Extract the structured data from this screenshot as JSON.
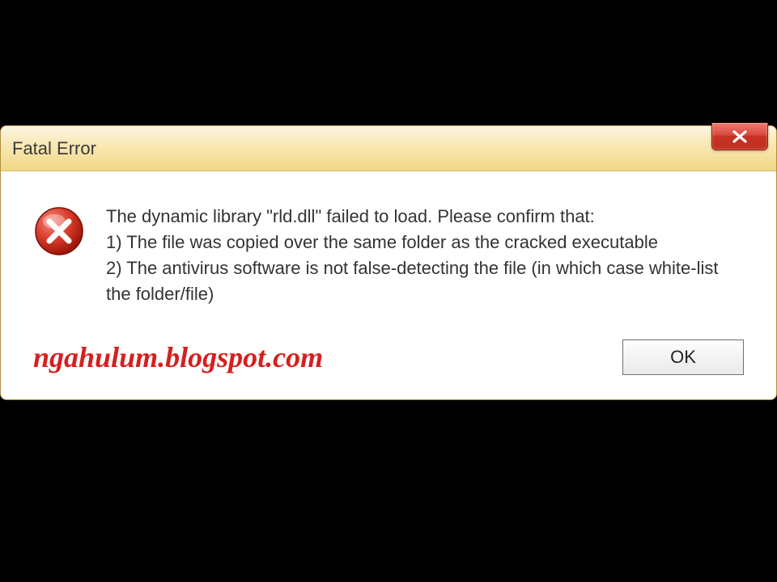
{
  "dialog": {
    "title": "Fatal Error",
    "message": "The dynamic library \"rld.dll\" failed to load. Please confirm that:\n1) The file was copied over the same folder as the cracked executable\n2) The antivirus software is not false-detecting the file (in which case white-list the folder/file)",
    "ok_label": "OK"
  },
  "watermark": "ngahulum.blogspot.com"
}
